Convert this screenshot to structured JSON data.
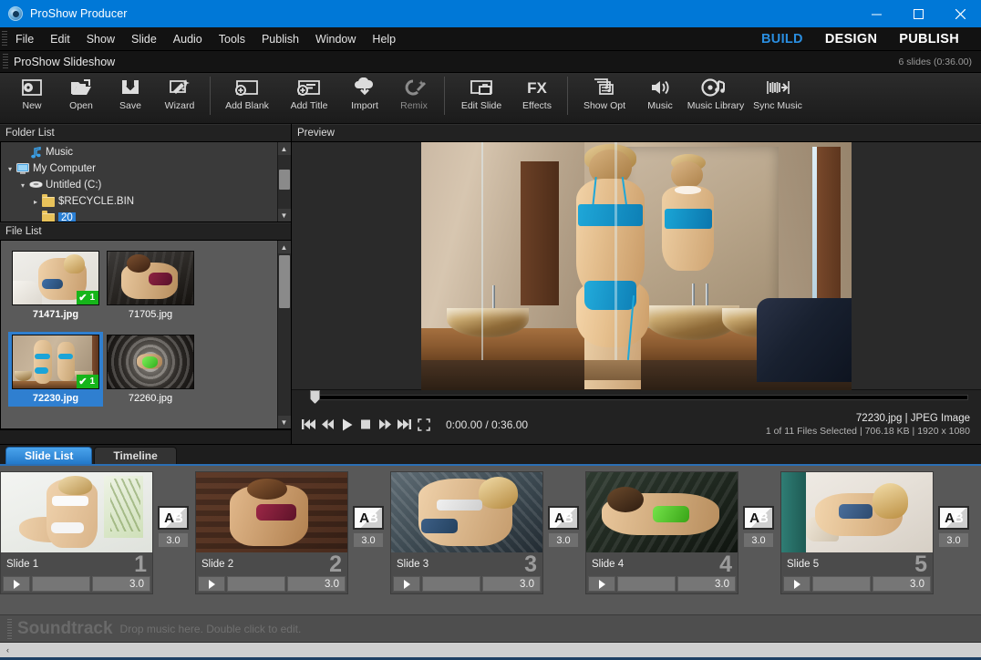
{
  "window": {
    "title": "ProShow Producer",
    "app_icon": "proshow-disc-icon",
    "minimize": "—",
    "maximize": "□",
    "close": "✕",
    "accent": "#0078d7"
  },
  "menubar": {
    "items": [
      "File",
      "Edit",
      "Show",
      "Slide",
      "Audio",
      "Tools",
      "Publish",
      "Window",
      "Help"
    ],
    "modes": [
      {
        "label": "BUILD",
        "active": true,
        "color": "#2a8ee0"
      },
      {
        "label": "DESIGN",
        "active": false
      },
      {
        "label": "PUBLISH",
        "active": false
      }
    ]
  },
  "showbar": {
    "name": "ProShow Slideshow",
    "count": "6 slides (0:36.00)"
  },
  "toolbar": {
    "groups": [
      [
        {
          "label": "New",
          "icon": "new-show-icon"
        },
        {
          "label": "Open",
          "icon": "open-folder-icon"
        },
        {
          "label": "Save",
          "icon": "save-icon"
        },
        {
          "label": "Wizard",
          "icon": "wizard-wand-icon"
        }
      ],
      [
        {
          "label": "Add Blank",
          "icon": "add-blank-slide-icon"
        },
        {
          "label": "Add Title",
          "icon": "add-title-slide-icon"
        },
        {
          "label": "Import",
          "icon": "import-cloud-icon"
        },
        {
          "label": "Remix",
          "icon": "remix-icon"
        }
      ],
      [
        {
          "label": "Edit Slide",
          "icon": "edit-slide-icon"
        },
        {
          "label": "Effects",
          "icon": "fx-icon"
        }
      ],
      [
        {
          "label": "Show Opt",
          "icon": "show-options-icon"
        },
        {
          "label": "Music",
          "icon": "speaker-icon"
        },
        {
          "label": "Music Library",
          "icon": "music-library-icon"
        },
        {
          "label": "Sync Music",
          "icon": "sync-music-icon"
        }
      ]
    ]
  },
  "folder_list": {
    "header": "Folder List",
    "items": [
      {
        "label": "Music",
        "icon": "music-note-icon",
        "indent": 1,
        "arrow": "",
        "selected": false
      },
      {
        "label": "My Computer",
        "icon": "computer-icon",
        "indent": 0,
        "arrow": "▾",
        "selected": false
      },
      {
        "label": "Untitled (C:)",
        "icon": "drive-icon",
        "indent": 1,
        "arrow": "▾",
        "selected": false
      },
      {
        "label": "$RECYCLE.BIN",
        "icon": "folder-icon",
        "indent": 2,
        "arrow": "▸",
        "selected": false
      },
      {
        "label": "20",
        "icon": "folder-icon",
        "indent": 2,
        "arrow": "",
        "selected": true
      }
    ]
  },
  "file_list": {
    "header": "File List",
    "items": [
      {
        "name": "71471.jpg",
        "art": "f1",
        "badge": "1",
        "checked": true,
        "selected": false
      },
      {
        "name": "71705.jpg",
        "art": "f2",
        "badge": "",
        "checked": false,
        "selected": false
      },
      {
        "name": "72230.jpg",
        "art": "f3",
        "badge": "1",
        "checked": true,
        "selected": true
      },
      {
        "name": "72260.jpg",
        "art": "f4",
        "badge": "",
        "checked": false,
        "selected": false
      }
    ],
    "badge_check": "✔"
  },
  "preview": {
    "header": "Preview",
    "transport": [
      {
        "name": "skip-to-start-button",
        "icon": "skip-start-icon"
      },
      {
        "name": "rewind-button",
        "icon": "rewind-icon"
      },
      {
        "name": "play-button",
        "icon": "play-icon"
      },
      {
        "name": "stop-button",
        "icon": "stop-icon"
      },
      {
        "name": "fast-forward-button",
        "icon": "fast-forward-icon"
      },
      {
        "name": "skip-to-end-button",
        "icon": "skip-end-icon"
      },
      {
        "name": "fullscreen-button",
        "icon": "fullscreen-icon"
      }
    ],
    "time": "0:00.00 / 0:36.00",
    "meta_line1": "72230.jpg  |  JPEG Image",
    "meta_line2": "1 of 11 Files Selected |  706.18 KB  |  1920 x 1080"
  },
  "tabs": [
    {
      "label": "Slide List",
      "active": true
    },
    {
      "label": "Timeline",
      "active": false
    }
  ],
  "slides": [
    {
      "label": "Slide 1",
      "number": "1",
      "duration": "3.0",
      "art": "s1",
      "transition_duration": "3.0"
    },
    {
      "label": "Slide 2",
      "number": "2",
      "duration": "3.0",
      "art": "s2",
      "transition_duration": "3.0"
    },
    {
      "label": "Slide 3",
      "number": "3",
      "duration": "3.0",
      "art": "s3",
      "transition_duration": "3.0"
    },
    {
      "label": "Slide 4",
      "number": "4",
      "duration": "3.0",
      "art": "s4",
      "transition_duration": "3.0"
    },
    {
      "label": "Slide 5",
      "number": "5",
      "duration": "3.0",
      "art": "s5",
      "transition_duration": "3.0"
    }
  ],
  "transition": {
    "glyph_a": "A",
    "glyph_b": "B"
  },
  "soundtrack": {
    "title": "Soundtrack",
    "hint": "Drop music here.  Double click to edit."
  },
  "hscroll": {
    "left_arrow": "‹",
    "right_arrow": "›"
  }
}
